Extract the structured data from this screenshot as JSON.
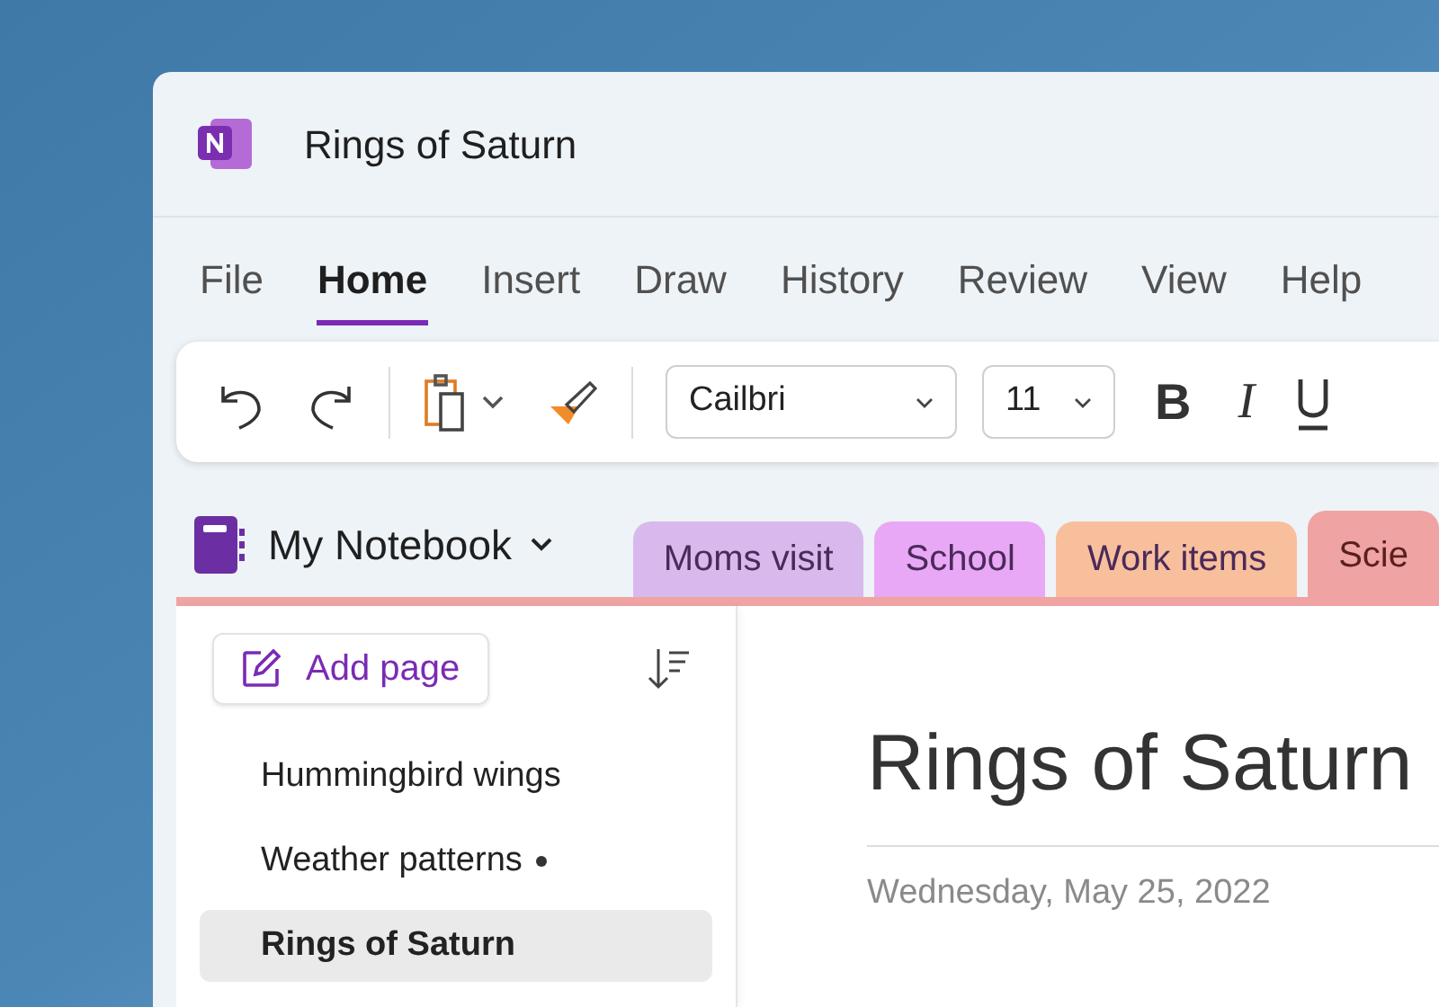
{
  "window": {
    "title": "Rings of Saturn"
  },
  "menu": [
    {
      "label": "File",
      "selected": false
    },
    {
      "label": "Home",
      "selected": true
    },
    {
      "label": "Insert",
      "selected": false
    },
    {
      "label": "Draw",
      "selected": false
    },
    {
      "label": "History",
      "selected": false
    },
    {
      "label": "Review",
      "selected": false
    },
    {
      "label": "View",
      "selected": false
    },
    {
      "label": "Help",
      "selected": false
    }
  ],
  "toolbar": {
    "font": "Cailbri",
    "size": "11",
    "bold": "B",
    "italic": "I"
  },
  "notebook": {
    "name": "My Notebook"
  },
  "sections": [
    {
      "label": "Moms visit",
      "color": "#d9b8ee",
      "selected": false
    },
    {
      "label": "School",
      "color": "#e9a8f5",
      "selected": false
    },
    {
      "label": "Work items",
      "color": "#f8bf9c",
      "selected": false
    },
    {
      "label": "Scie",
      "color": "#f0a3a3",
      "selected": true
    }
  ],
  "sidebar": {
    "add_page": "Add page",
    "pages": [
      {
        "label": "Hummingbird wings",
        "selected": false,
        "unsynced": false
      },
      {
        "label": "Weather patterns",
        "selected": false,
        "unsynced": true
      },
      {
        "label": "Rings of Saturn",
        "selected": true,
        "unsynced": false
      }
    ]
  },
  "page": {
    "title": "Rings of Saturn",
    "date": "Wednesday, May 25, 2022"
  }
}
